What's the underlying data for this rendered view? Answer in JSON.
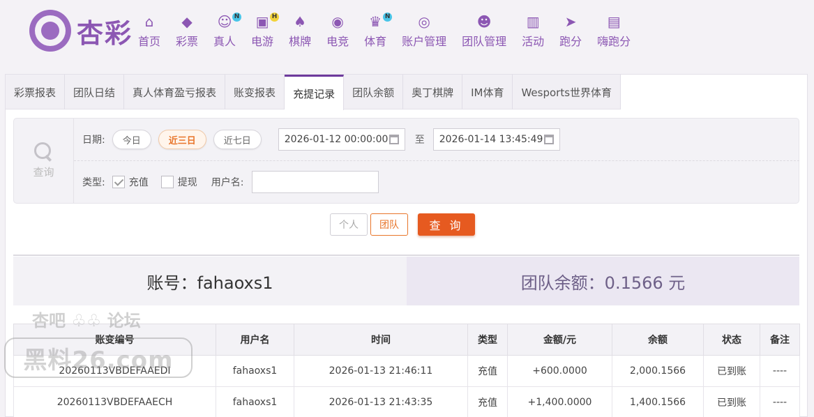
{
  "brand": {
    "logo_text": "杏彩"
  },
  "nav": [
    {
      "icon": "home-icon",
      "label": "首页"
    },
    {
      "icon": "lottery-ticket-icon",
      "label": "彩票"
    },
    {
      "icon": "dealer-icon",
      "label": "真人",
      "badge": "N"
    },
    {
      "icon": "gamepad-icon",
      "label": "电游",
      "badge": "H"
    },
    {
      "icon": "cards-icon",
      "label": "棋牌"
    },
    {
      "icon": "esports-controller-icon",
      "label": "电竞"
    },
    {
      "icon": "trophy-icon",
      "label": "体育",
      "badge": "N"
    },
    {
      "icon": "account-coin-icon",
      "label": "账户管理"
    },
    {
      "icon": "team-icon",
      "label": "团队管理"
    },
    {
      "icon": "gift-icon",
      "label": "活动"
    },
    {
      "icon": "running-car-icon",
      "label": "跑分"
    },
    {
      "icon": "hi-app-icon",
      "label": "嗨跑分"
    }
  ],
  "tabs": [
    "彩票报表",
    "团队日结",
    "真人体育盈亏报表",
    "账变报表",
    "充提记录",
    "团队余额",
    "奥丁棋牌",
    "IM体育",
    "Wesports世界体育"
  ],
  "active_tab": "充提记录",
  "search": {
    "side_label": "查询",
    "date_label": "日期:",
    "quick_ranges": [
      "今日",
      "近三日",
      "近七日"
    ],
    "active_range": "近三日",
    "start_date": "2026-01-12 00:00:00",
    "to_label": "至",
    "end_date": "2026-01-14 13:45:49",
    "type_label": "类型:",
    "type_recharge": "充值",
    "type_recharge_checked": true,
    "type_withdraw": "提现",
    "type_withdraw_checked": false,
    "username_label": "用户名:",
    "username_value": ""
  },
  "buttons": {
    "personal": "个人",
    "team": "团队",
    "active_mode": "团队",
    "query": "查 询"
  },
  "summary": {
    "account": "账号：fahaoxs1",
    "team_balance": "团队余额：0.1566 元"
  },
  "table": {
    "headers": [
      "账变编号",
      "用户名",
      "时间",
      "类型",
      "金额/元",
      "余额",
      "状态",
      "备注"
    ],
    "rows": [
      [
        "20260113VBDEFAAEDI",
        "fahaoxs1",
        "2026-01-13 21:46:11",
        "充值",
        "+600.0000",
        "2,000.1566",
        "已到账",
        "----"
      ],
      [
        "20260113VBDEFAAECH",
        "fahaoxs1",
        "2026-01-13 21:43:35",
        "充值",
        "+1,400.0000",
        "1,400.1566",
        "已到账",
        "----"
      ]
    ]
  },
  "watermark": {
    "line1": "杏吧 ♧♧ 论坛",
    "line2": "黑料26.com"
  },
  "colors": {
    "brand_purple": "#8c57b3",
    "accent_orange": "#e65a20",
    "amount_green": "#6a9c2a",
    "status_green": "#5ba22d"
  }
}
